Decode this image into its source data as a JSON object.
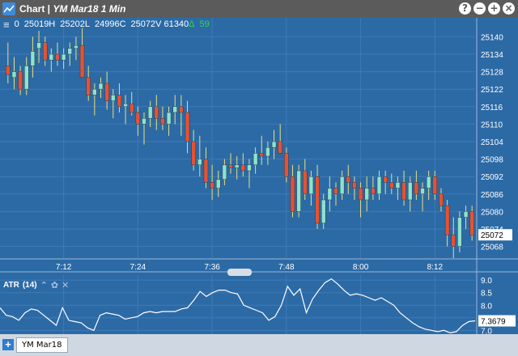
{
  "window": {
    "title": "Chart",
    "separator": " | ",
    "symbol_title": "YM Mar18 1 Min",
    "buttons": [
      "?",
      "−",
      "+",
      "×"
    ]
  },
  "quote": {
    "menu_icon": "hamburger-icon",
    "open": "0",
    "high": "25019H",
    "low": "25202L",
    "close": "24996C",
    "last": "25072V",
    "volume": "61340",
    "change_symbol": "Δ",
    "change": "59"
  },
  "colors": {
    "background": "#2c6aa6",
    "up_candle": "#8fe3c8",
    "down_candle": "#e8522e",
    "wick": "#e8e07a",
    "titlebar": "#5b5b5b",
    "change_up": "#33d44b"
  },
  "price_axis": {
    "ticks": [
      "25140",
      "25134",
      "25128",
      "25122",
      "25116",
      "25110",
      "25104",
      "25098",
      "25092",
      "25086",
      "25080",
      "25074",
      "25068"
    ],
    "last_price_label": "25072"
  },
  "time_axis": {
    "ticks": [
      "7:12",
      "7:24",
      "7:36",
      "7:48",
      "8:00",
      "8:12"
    ]
  },
  "atr": {
    "label": "ATR",
    "period": "(14)",
    "icons": [
      "collapse-icon",
      "settings-icon",
      "close-icon"
    ],
    "axis_ticks": [
      "9.0",
      "8.5",
      "8.0",
      "7.5",
      "7.0"
    ],
    "last_value_label": "7.3679"
  },
  "tabs": {
    "add_icon": "plus-icon",
    "items": [
      "YM Mar18"
    ]
  },
  "chart_data": [
    {
      "type": "candlestick",
      "ylim": [
        25064,
        25144
      ],
      "x_tick_labels": [
        "7:12",
        "7:24",
        "7:36",
        "7:48",
        "8:00",
        "8:12"
      ],
      "candles": [
        [
          25130,
          25138,
          25124,
          25127
        ],
        [
          25126,
          25133,
          25122,
          25128
        ],
        [
          25128,
          25130,
          25120,
          25122
        ],
        [
          25122,
          25133,
          25120,
          25130
        ],
        [
          25130,
          25140,
          25126,
          25135
        ],
        [
          25136,
          25142,
          25131,
          25138
        ],
        [
          25138,
          25140,
          25130,
          25132
        ],
        [
          25132,
          25136,
          25128,
          25134
        ],
        [
          25134,
          25138,
          25130,
          25132
        ],
        [
          25132,
          25136,
          25129,
          25134
        ],
        [
          25134,
          25138,
          25130,
          25136
        ],
        [
          25136,
          25140,
          25132,
          25137
        ],
        [
          25137,
          25143,
          25128,
          25126
        ],
        [
          25126,
          25130,
          25118,
          25120
        ],
        [
          25120,
          25124,
          25113,
          25122
        ],
        [
          25122,
          25126,
          25119,
          25124
        ],
        [
          25124,
          25128,
          25115,
          25118
        ],
        [
          25118,
          25122,
          25112,
          25120
        ],
        [
          25120,
          25124,
          25114,
          25116
        ],
        [
          25116,
          25120,
          25110,
          25117
        ],
        [
          25117,
          25121,
          25113,
          25114
        ],
        [
          25114,
          25116,
          25106,
          25110
        ],
        [
          25110,
          25114,
          25103,
          25112
        ],
        [
          25112,
          25118,
          25109,
          25116
        ],
        [
          25116,
          25120,
          25108,
          25112
        ],
        [
          25112,
          25116,
          25108,
          25110
        ],
        [
          25110,
          25116,
          25106,
          25114
        ],
        [
          25114,
          25120,
          25110,
          25116
        ],
        [
          25116,
          25120,
          25106,
          25114
        ],
        [
          25114,
          25118,
          25100,
          25104
        ],
        [
          25104,
          25108,
          25094,
          25096
        ],
        [
          25096,
          25106,
          25092,
          25098
        ],
        [
          25098,
          25102,
          25088,
          25090
        ],
        [
          25090,
          25096,
          25084,
          25088
        ],
        [
          25088,
          25094,
          25085,
          25091
        ],
        [
          25091,
          25098,
          25089,
          25096
        ],
        [
          25096,
          25100,
          25093,
          25095
        ],
        [
          25095,
          25099,
          25091,
          25096
        ],
        [
          25096,
          25100,
          25092,
          25094
        ],
        [
          25094,
          25098,
          25088,
          25096
        ],
        [
          25096,
          25102,
          25093,
          25100
        ],
        [
          25100,
          25106,
          25096,
          25099
        ],
        [
          25099,
          25104,
          25096,
          25102
        ],
        [
          25102,
          25108,
          25098,
          25104
        ],
        [
          25104,
          25110,
          25102,
          25100
        ],
        [
          25100,
          25102,
          25090,
          25092
        ],
        [
          25092,
          25096,
          25078,
          25080
        ],
        [
          25080,
          25096,
          25078,
          25094
        ],
        [
          25094,
          25098,
          25084,
          25086
        ],
        [
          25086,
          25094,
          25082,
          25092
        ],
        [
          25092,
          25096,
          25074,
          25076
        ],
        [
          25076,
          25086,
          25074,
          25084
        ],
        [
          25084,
          25092,
          25080,
          25088
        ],
        [
          25088,
          25090,
          25082,
          25086
        ],
        [
          25086,
          25094,
          25084,
          25092
        ],
        [
          25092,
          25096,
          25086,
          25090
        ],
        [
          25090,
          25092,
          25084,
          25088
        ],
        [
          25088,
          25090,
          25078,
          25084
        ],
        [
          25084,
          25092,
          25080,
          25088
        ],
        [
          25088,
          25092,
          25084,
          25086
        ],
        [
          25086,
          25094,
          25084,
          25092
        ],
        [
          25092,
          25094,
          25086,
          25090
        ],
        [
          25090,
          25093,
          25086,
          25088
        ],
        [
          25088,
          25092,
          25084,
          25090
        ],
        [
          25090,
          25094,
          25082,
          25084
        ],
        [
          25084,
          25092,
          25080,
          25090
        ],
        [
          25090,
          25094,
          25084,
          25086
        ],
        [
          25086,
          25090,
          25080,
          25088
        ],
        [
          25088,
          25094,
          25084,
          25092
        ],
        [
          25092,
          25094,
          25084,
          25086
        ],
        [
          25086,
          25088,
          25080,
          25082
        ],
        [
          25082,
          25084,
          25068,
          25072
        ],
        [
          25072,
          25078,
          25064,
          25068
        ],
        [
          25068,
          25080,
          25066,
          25078
        ],
        [
          25078,
          25082,
          25074,
          25080
        ],
        [
          25080,
          25082,
          25070,
          25072
        ]
      ],
      "last_price": 25072
    },
    {
      "type": "line",
      "name": "ATR (14)",
      "ylim": [
        6.85,
        9.2
      ],
      "values": [
        7.9,
        7.6,
        7.55,
        7.4,
        7.7,
        7.85,
        7.8,
        7.6,
        7.4,
        7.2,
        7.9,
        7.4,
        7.35,
        7.3,
        7.1,
        7.0,
        7.6,
        7.7,
        7.65,
        7.6,
        7.45,
        7.5,
        7.55,
        7.7,
        7.75,
        7.7,
        7.75,
        7.75,
        7.75,
        7.85,
        7.9,
        8.2,
        8.55,
        8.35,
        8.5,
        8.6,
        8.6,
        8.5,
        8.45,
        8.0,
        7.9,
        7.8,
        7.7,
        7.4,
        7.55,
        8.0,
        8.75,
        8.4,
        8.65,
        7.7,
        8.25,
        8.6,
        8.9,
        9.05,
        8.85,
        8.6,
        8.4,
        8.45,
        8.4,
        8.3,
        8.2,
        8.3,
        8.15,
        8.0,
        7.7,
        7.5,
        7.3,
        7.15,
        7.05,
        7.0,
        6.95,
        7.0,
        6.9,
        6.95,
        7.2,
        7.35,
        7.38
      ]
    }
  ]
}
